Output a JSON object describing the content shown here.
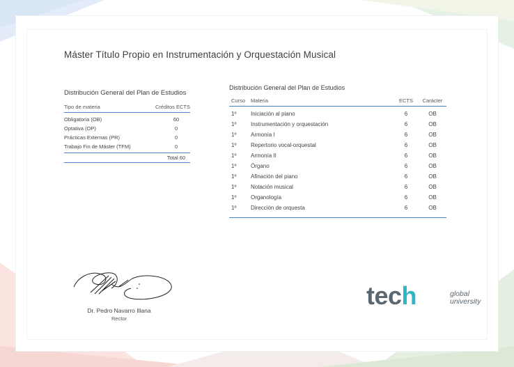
{
  "title": "Máster Título Propio en Instrumentación y Orquestación Musical",
  "left_table": {
    "title": "Distribución General del Plan de Estudios",
    "header_type": "Tipo de materia",
    "header_credits": "Créditos ECTS",
    "rows": [
      {
        "type": "Obligatoria (OB)",
        "credits": "60"
      },
      {
        "type": "Optativa (OP)",
        "credits": "0"
      },
      {
        "type": "Prácticas Externas (PR)",
        "credits": "0"
      },
      {
        "type": "Trabajo Fin de Máster (TFM)",
        "credits": "0"
      }
    ],
    "total": "Total 60"
  },
  "right_table": {
    "title": "Distribución General del Plan de Estudios",
    "header_curso": "Curso",
    "header_materia": "Materia",
    "header_ects": "ECTS",
    "header_caracter": "Carácter",
    "rows": [
      {
        "curso": "1º",
        "materia": "Iniciación al piano",
        "ects": "6",
        "caracter": "OB"
      },
      {
        "curso": "1º",
        "materia": "Instrumentación y orquestación",
        "ects": "6",
        "caracter": "OB"
      },
      {
        "curso": "1º",
        "materia": "Armonía I",
        "ects": "6",
        "caracter": "OB"
      },
      {
        "curso": "1º",
        "materia": "Repertorio vocal-orquestal",
        "ects": "6",
        "caracter": "OB"
      },
      {
        "curso": "1º",
        "materia": "Armonía II",
        "ects": "6",
        "caracter": "OB"
      },
      {
        "curso": "1º",
        "materia": "Órgano",
        "ects": "6",
        "caracter": "OB"
      },
      {
        "curso": "1º",
        "materia": "Afinación del piano",
        "ects": "6",
        "caracter": "OB"
      },
      {
        "curso": "1º",
        "materia": "Notación musical",
        "ects": "6",
        "caracter": "OB"
      },
      {
        "curso": "1º",
        "materia": "Organología",
        "ects": "6",
        "caracter": "OB"
      },
      {
        "curso": "1º",
        "materia": "Dirección de orquesta",
        "ects": "6",
        "caracter": "OB"
      }
    ]
  },
  "signatory": {
    "name": "Dr. Pedro Navarro Illana",
    "role": "Rector"
  },
  "logo": {
    "word_tec": "tec",
    "word_h": "h",
    "line1": "global",
    "line2": "university",
    "accent_color": "#2fb6c6"
  },
  "colors": {
    "rule": "#4a7fc1",
    "text": "#3e3e3e"
  }
}
